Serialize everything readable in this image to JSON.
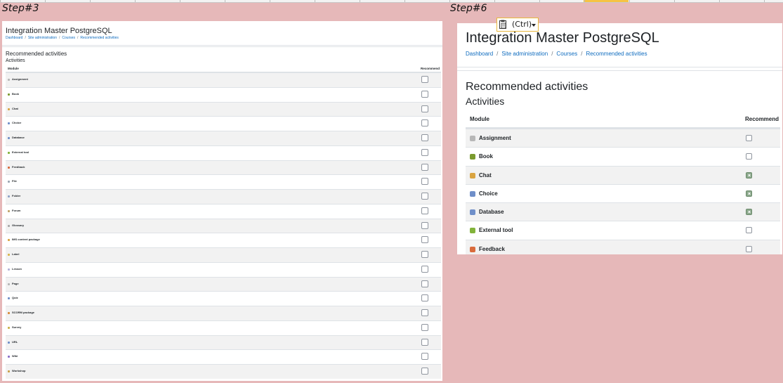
{
  "colors": {
    "background": "#e6b8b9",
    "link": "#0f6cbf",
    "row_alt": "#f2f2f2",
    "checked": "#8ca98c",
    "chip_border": "#e8b73b"
  },
  "step3": {
    "label": "Step#3",
    "title": "Integration Master PostgreSQL",
    "breadcrumb": [
      "Dashboard",
      "Site administration",
      "Courses",
      "Recommended activities"
    ],
    "heading": "Recommended activities",
    "subheading": "Activities",
    "columns": {
      "module": "Module",
      "recommend": "Recommend"
    },
    "rows": [
      {
        "name": "Assignment",
        "icon": "assignment-icon",
        "color": "#b7b7b7",
        "checked": false
      },
      {
        "name": "Book",
        "icon": "book-icon",
        "color": "#7a9a2e",
        "checked": false
      },
      {
        "name": "Chat",
        "icon": "chat-icon",
        "color": "#d9a441",
        "checked": false
      },
      {
        "name": "Choice",
        "icon": "choice-icon",
        "color": "#6f8fc9",
        "checked": false
      },
      {
        "name": "Database",
        "icon": "database-icon",
        "color": "#6f8fc9",
        "checked": false
      },
      {
        "name": "External tool",
        "icon": "puzzle-icon",
        "color": "#82b33b",
        "checked": false
      },
      {
        "name": "Feedback",
        "icon": "megaphone-icon",
        "color": "#d96b3c",
        "checked": false
      },
      {
        "name": "File",
        "icon": "file-icon",
        "color": "#9aa6b2",
        "checked": false
      },
      {
        "name": "Folder",
        "icon": "folder-icon",
        "color": "#8fa3c8",
        "checked": false
      },
      {
        "name": "Forum",
        "icon": "forum-icon",
        "color": "#c0a56a",
        "checked": false
      },
      {
        "name": "Glossary",
        "icon": "glossary-icon",
        "color": "#a9a9a9",
        "checked": false
      },
      {
        "name": "IMS content package",
        "icon": "package-icon",
        "color": "#d9a441",
        "checked": false
      },
      {
        "name": "Label",
        "icon": "label-icon",
        "color": "#d9b54a",
        "checked": false
      },
      {
        "name": "Lesson",
        "icon": "lesson-icon",
        "color": "#b3b3d9",
        "checked": false
      },
      {
        "name": "Page",
        "icon": "page-icon",
        "color": "#b7b7b7",
        "checked": false
      },
      {
        "name": "Quiz",
        "icon": "quiz-icon",
        "color": "#6f8fc9",
        "checked": false
      },
      {
        "name": "SCORM package",
        "icon": "scorm-icon",
        "color": "#d98c3c",
        "checked": false
      },
      {
        "name": "Survey",
        "icon": "survey-icon",
        "color": "#c9b34a",
        "checked": false
      },
      {
        "name": "URL",
        "icon": "url-icon",
        "color": "#6f8fc9",
        "checked": false
      },
      {
        "name": "Wiki",
        "icon": "wiki-icon",
        "color": "#8a6fc9",
        "checked": false
      },
      {
        "name": "Workshop",
        "icon": "workshop-icon",
        "color": "#c9a14a",
        "checked": false
      }
    ]
  },
  "step6": {
    "label": "Step#6",
    "title": "Integration Master PostgreSQL",
    "breadcrumb": [
      "Dashboard",
      "Site administration",
      "Courses",
      "Recommended activities"
    ],
    "heading": "Recommended activities",
    "subheading": "Activities",
    "columns": {
      "module": "Module",
      "recommend": "Recommend"
    },
    "rows": [
      {
        "name": "Assignment",
        "icon": "assignment-icon",
        "color": "#b7b7b7",
        "checked": false
      },
      {
        "name": "Book",
        "icon": "book-icon",
        "color": "#7a9a2e",
        "checked": false
      },
      {
        "name": "Chat",
        "icon": "chat-icon",
        "color": "#d9a441",
        "checked": true
      },
      {
        "name": "Choice",
        "icon": "choice-icon",
        "color": "#6f8fc9",
        "checked": true
      },
      {
        "name": "Database",
        "icon": "database-icon",
        "color": "#6f8fc9",
        "checked": true
      },
      {
        "name": "External tool",
        "icon": "puzzle-icon",
        "color": "#82b33b",
        "checked": false
      },
      {
        "name": "Feedback",
        "icon": "megaphone-icon",
        "color": "#d96b3c",
        "checked": false
      }
    ]
  },
  "paste_options": {
    "label": "(Ctrl)",
    "icon": "clipboard-icon"
  }
}
